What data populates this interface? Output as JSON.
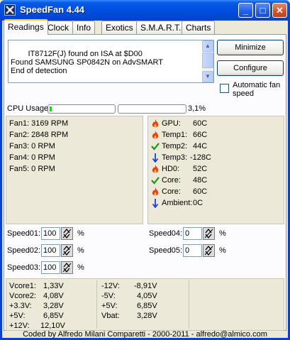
{
  "window": {
    "title": "SpeedFan 4.44",
    "minimize_glyph": "_",
    "maximize_glyph": "□",
    "close_glyph": "✕"
  },
  "tabs": [
    {
      "label": "Readings",
      "active": true
    },
    {
      "label": "Clock",
      "active": false
    },
    {
      "label": "Info",
      "active": false
    },
    {
      "label": "Exotics",
      "active": false
    },
    {
      "label": "S.M.A.R.T.",
      "active": false
    },
    {
      "label": "Charts",
      "active": false
    }
  ],
  "log": {
    "lines": "IT8712F(J) found on ISA at $D00\nFound SAMSUNG SP0842N on AdvSMART\nEnd of detection"
  },
  "buttons": {
    "minimize": "Minimize",
    "configure": "Configure"
  },
  "auto_fan_speed": {
    "label": "Automatic fan speed",
    "checked": false
  },
  "cpu_usage": {
    "label": "CPU Usage",
    "percent_text": "3,1%",
    "core1_fraction": 0.031,
    "core2_fraction": 0.0
  },
  "fans": [
    "Fan1: 3169 RPM",
    "Fan2: 2848 RPM",
    "Fan3: 0 RPM",
    "Fan4: 0 RPM",
    "Fan5: 0 RPM"
  ],
  "temps": [
    {
      "name": "GPU:",
      "value": "60C",
      "icon": "flame-icon"
    },
    {
      "name": "Temp1:",
      "value": "66C",
      "icon": "flame-icon"
    },
    {
      "name": "Temp2:",
      "value": "44C",
      "icon": "check-icon"
    },
    {
      "name": "Temp3:",
      "value": "-128C",
      "icon": "down-arrow-icon"
    },
    {
      "name": "HD0:",
      "value": "52C",
      "icon": "flame-icon"
    },
    {
      "name": "Core:",
      "value": "48C",
      "icon": "check-icon"
    },
    {
      "name": "Core:",
      "value": "60C",
      "icon": "flame-icon"
    },
    {
      "name": "Ambient:",
      "value": "0C",
      "icon": "down-arrow-icon"
    }
  ],
  "speeds": [
    {
      "label": "Speed01:",
      "value": "100",
      "unit": "%"
    },
    {
      "label": "Speed02:",
      "value": "100",
      "unit": "%"
    },
    {
      "label": "Speed03:",
      "value": "100",
      "unit": "%"
    },
    {
      "label": "Speed04:",
      "value": "0",
      "unit": "%"
    },
    {
      "label": "Speed05:",
      "value": "0",
      "unit": "%"
    }
  ],
  "voltages_left": [
    {
      "name": "Vcore1:",
      "value": "1,33V"
    },
    {
      "name": "Vcore2:",
      "value": "4,08V"
    },
    {
      "name": "+3.3V:",
      "value": "3,28V"
    },
    {
      "name": "+5V:",
      "value": "6,85V"
    },
    {
      "name": "+12V:",
      "value": "12,10V"
    }
  ],
  "voltages_right": [
    {
      "name": "-12V:",
      "value": "-8,91V"
    },
    {
      "name": "-5V:",
      "value": "4,05V"
    },
    {
      "name": "+5V:",
      "value": "6,85V"
    },
    {
      "name": "Vbat:",
      "value": "3,28V"
    }
  ],
  "footer": "Coded by Alfredo Milani Comparetti - 2000-2011 - alfredo@almico.com",
  "colors": {
    "flame": "#e8401c",
    "check": "#1a9a1a",
    "down_arrow": "#1f3fd0",
    "cpu_fill": "#2ec82e"
  }
}
